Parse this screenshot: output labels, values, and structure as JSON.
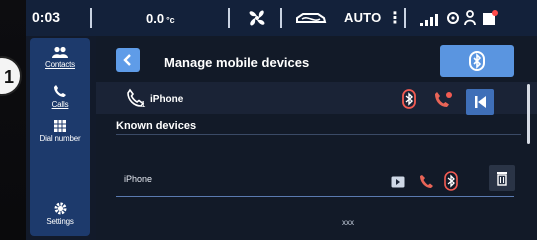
{
  "status": {
    "time": "0:03",
    "temperature": "0.0",
    "temperature_unit": "°c",
    "auto_label": "AUTO",
    "dots": "⋮"
  },
  "sidebar": {
    "items": [
      {
        "label": "Contacts",
        "icon": "contacts-icon",
        "selected": true
      },
      {
        "label": "Calls",
        "icon": "call-icon",
        "selected": true
      },
      {
        "label": "Dial number",
        "icon": "dialpad-icon",
        "selected": false
      },
      {
        "label": "Settings",
        "icon": "settings-icon",
        "selected": false
      }
    ]
  },
  "header": {
    "title": "Manage mobile devices"
  },
  "connected_device": {
    "name": "iPhone",
    "line_number": "1"
  },
  "known_devices": {
    "title": "Known devices",
    "items": [
      {
        "name": "iPhone"
      }
    ]
  },
  "footer": {
    "text": "xxx"
  },
  "colors": {
    "accent": "#5f9ce8",
    "sidebar_bg": "#1d3a6c",
    "bluetooth": "#f25b52"
  },
  "callout_mark": "1"
}
